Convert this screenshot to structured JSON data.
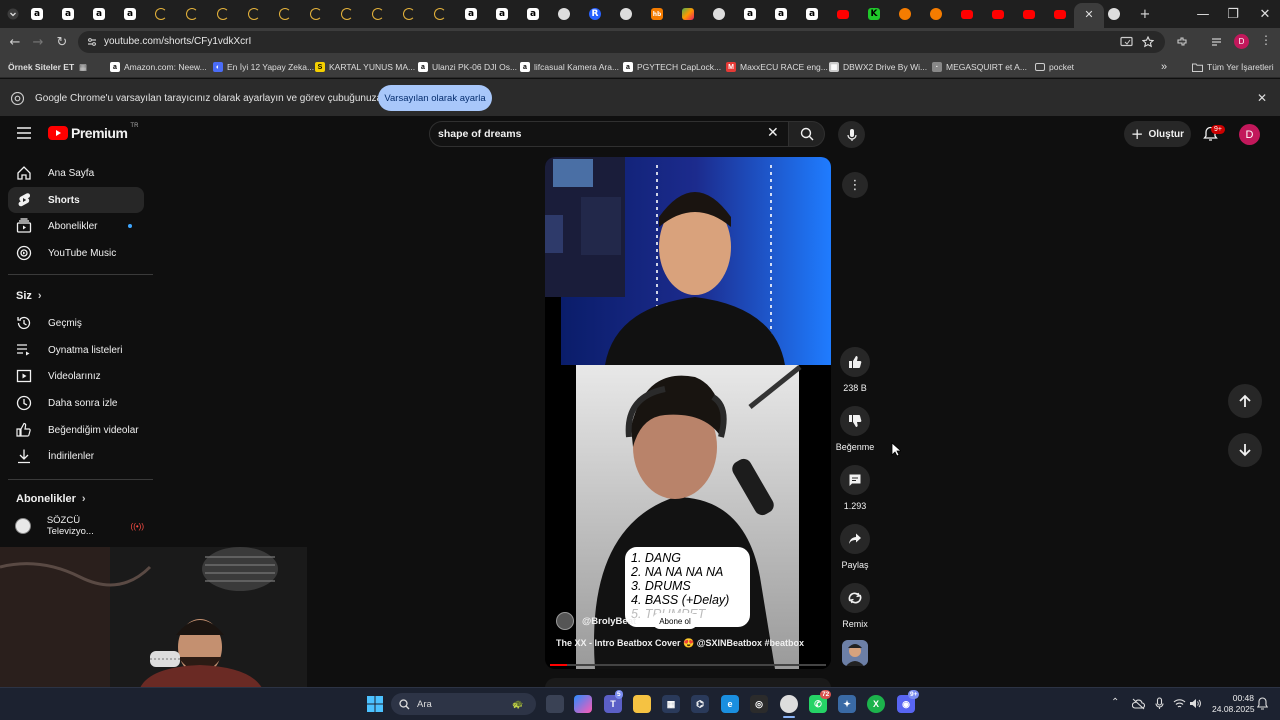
{
  "browser": {
    "url": "youtube.com/shorts/CFy1vdkXcrI",
    "tab_favicons": [
      "a",
      "a",
      "a",
      "a",
      "loading",
      "loading",
      "loading",
      "loading",
      "loading",
      "loading",
      "loading",
      "loading",
      "loading",
      "loading",
      "a",
      "a",
      "a",
      "chrome",
      "R",
      "chrome",
      "hb",
      "3d",
      "chrome",
      "a",
      "a",
      "a",
      "yt",
      "K",
      "circle",
      "circle",
      "yt",
      "yt",
      "yt",
      "yt"
    ],
    "window_controls": {
      "minimize": "—",
      "maximize": "❐",
      "close": "✕",
      "new_tab": "+"
    },
    "bookmarks": [
      {
        "label": "Örnek Siteler ET",
        "icon": "",
        "color": "#3c3c3c"
      },
      {
        "label": "Amazon.com: Neew...",
        "icon": "a",
        "color": "#ffffff"
      },
      {
        "label": "En İyi 12 Yapay Zeka...",
        "icon": "◐",
        "color": "#4a6cf7"
      },
      {
        "label": "KARTAL YUNUS MA...",
        "icon": "S",
        "color": "#f5d000"
      },
      {
        "label": "Ulanzi PK-06 DJI Os...",
        "icon": "a",
        "color": "#ffffff"
      },
      {
        "label": "lifcasual Kamera Ara...",
        "icon": "a",
        "color": "#ffffff"
      },
      {
        "label": "PGYTECH CapLock...",
        "icon": "a",
        "color": "#ffffff"
      },
      {
        "label": "MaxxECU RACE eng...",
        "icon": "M",
        "color": "#e53935"
      },
      {
        "label": "DBWX2 Drive By Wi...",
        "icon": "▦",
        "color": "#cccccc"
      },
      {
        "label": "MEGASQUIRT et A...",
        "icon": "·",
        "color": "#888888"
      },
      {
        "label": "pocket",
        "icon": "folder",
        "color": "#cccccc"
      }
    ],
    "bookmarks_more": "»",
    "all_bookmarks": "Tüm Yer İşaretleri",
    "infobar": {
      "text": "Google Chrome'u varsayılan tarayıcınız olarak ayarlayın ve görev çubuğunuza sabitleyin",
      "button": "Varsayılan olarak ayarla"
    },
    "profile_initial": "D"
  },
  "youtube": {
    "logo_text": "Premium",
    "logo_badge": "TR",
    "search": {
      "value": "shape of dreams"
    },
    "create_label": "Oluştur",
    "notifications_badge": "9+",
    "avatar_initial": "D",
    "sidebar": {
      "main": [
        {
          "label": "Ana Sayfa",
          "icon": "home"
        },
        {
          "label": "Shorts",
          "icon": "shorts",
          "active": true
        },
        {
          "label": "Abonelikler",
          "icon": "subscriptions",
          "dot": true
        },
        {
          "label": "YouTube Music",
          "icon": "music"
        }
      ],
      "you_heading": "Siz",
      "you": [
        {
          "label": "Geçmiş",
          "icon": "history"
        },
        {
          "label": "Oynatma listeleri",
          "icon": "playlists"
        },
        {
          "label": "Videolarınız",
          "icon": "your-videos"
        },
        {
          "label": "Daha sonra izle",
          "icon": "watch-later"
        },
        {
          "label": "Beğendiğim videolar",
          "icon": "liked"
        },
        {
          "label": "İndirilenler",
          "icon": "downloads"
        }
      ],
      "subs_heading": "Abonelikler",
      "subs": [
        {
          "label": "SÖZCÜ Televizyo...",
          "avatar": "sözcü",
          "live": true
        }
      ]
    },
    "short": {
      "channel": "@BrolyBeat",
      "subscribe": "Abone ol",
      "title": "The XX - Intro Beatbox Cover 😍 @SXINBeatbox #beatbox",
      "overlay_list": [
        "1. DANG",
        "2. NA NA NA NA",
        "3. DRUMS",
        "4. BASS (+Delay)",
        "5. TRUMPET"
      ],
      "actions": {
        "like": "238 B",
        "dislike": "Beğenme",
        "comments": "1.293",
        "share": "Paylaş",
        "remix": "Remix"
      }
    }
  },
  "taskbar": {
    "search": "Ara",
    "time": "00:48",
    "date": "24.08.2025",
    "badges": {
      "teams": "5",
      "whatsapp": "72",
      "discord": "9+"
    }
  }
}
